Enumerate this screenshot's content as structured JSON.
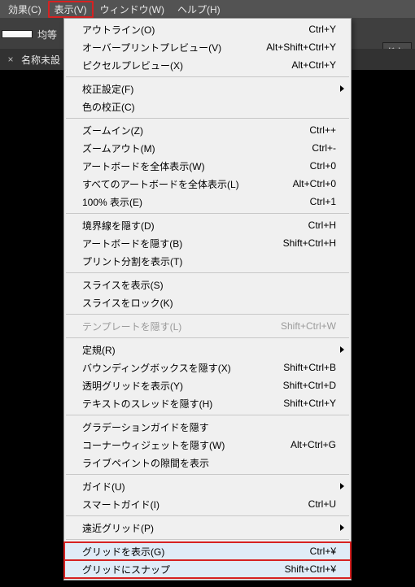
{
  "menubar": {
    "effect": "効果(C)",
    "view": "表示(V)",
    "window": "ウィンドウ(W)",
    "help": "ヘルプ(H)"
  },
  "toolbar": {
    "alignLabel": "均等",
    "docBtn": "ドキ"
  },
  "tab": {
    "close": "×",
    "title": "名称未設"
  },
  "menu": {
    "outline": {
      "label": "アウトライン(O)",
      "sc": "Ctrl+Y"
    },
    "overprint": {
      "label": "オーバープリントプレビュー(V)",
      "sc": "Alt+Shift+Ctrl+Y"
    },
    "pixelprev": {
      "label": "ピクセルプレビュー(X)",
      "sc": "Alt+Ctrl+Y"
    },
    "proofsetup": {
      "label": "校正設定(F)"
    },
    "proofcolor": {
      "label": "色の校正(C)"
    },
    "zoomin": {
      "label": "ズームイン(Z)",
      "sc": "Ctrl++"
    },
    "zoomout": {
      "label": "ズームアウト(M)",
      "sc": "Ctrl+-"
    },
    "fitartboard": {
      "label": "アートボードを全体表示(W)",
      "sc": "Ctrl+0"
    },
    "fitall": {
      "label": "すべてのアートボードを全体表示(L)",
      "sc": "Alt+Ctrl+0"
    },
    "actualsize": {
      "label": "100% 表示(E)",
      "sc": "Ctrl+1"
    },
    "hideedges": {
      "label": "境界線を隠す(D)",
      "sc": "Ctrl+H"
    },
    "hideartboards": {
      "label": "アートボードを隠す(B)",
      "sc": "Shift+Ctrl+H"
    },
    "printtiling": {
      "label": "プリント分割を表示(T)"
    },
    "showslices": {
      "label": "スライスを表示(S)"
    },
    "lockslices": {
      "label": "スライスをロック(K)"
    },
    "hidetemplate": {
      "label": "テンプレートを隠す(L)",
      "sc": "Shift+Ctrl+W"
    },
    "rulers": {
      "label": "定規(R)"
    },
    "hidebbox": {
      "label": "バウンディングボックスを隠す(X)",
      "sc": "Shift+Ctrl+B"
    },
    "showtgrid": {
      "label": "透明グリッドを表示(Y)",
      "sc": "Shift+Ctrl+D"
    },
    "hidethreads": {
      "label": "テキストのスレッドを隠す(H)",
      "sc": "Shift+Ctrl+Y"
    },
    "hidegradient": {
      "label": "グラデーションガイドを隠す"
    },
    "hidecorner": {
      "label": "コーナーウィジェットを隠す(W)",
      "sc": "Alt+Ctrl+G"
    },
    "livepaintgap": {
      "label": "ライブペイントの隙間を表示"
    },
    "guides": {
      "label": "ガイド(U)"
    },
    "smartguides": {
      "label": "スマートガイド(I)",
      "sc": "Ctrl+U"
    },
    "perspective": {
      "label": "遠近グリッド(P)"
    },
    "showgrid": {
      "label": "グリッドを表示(G)",
      "sc": "Ctrl+¥"
    },
    "snaptogrid": {
      "label": "グリッドにスナップ",
      "sc": "Shift+Ctrl+¥"
    }
  }
}
